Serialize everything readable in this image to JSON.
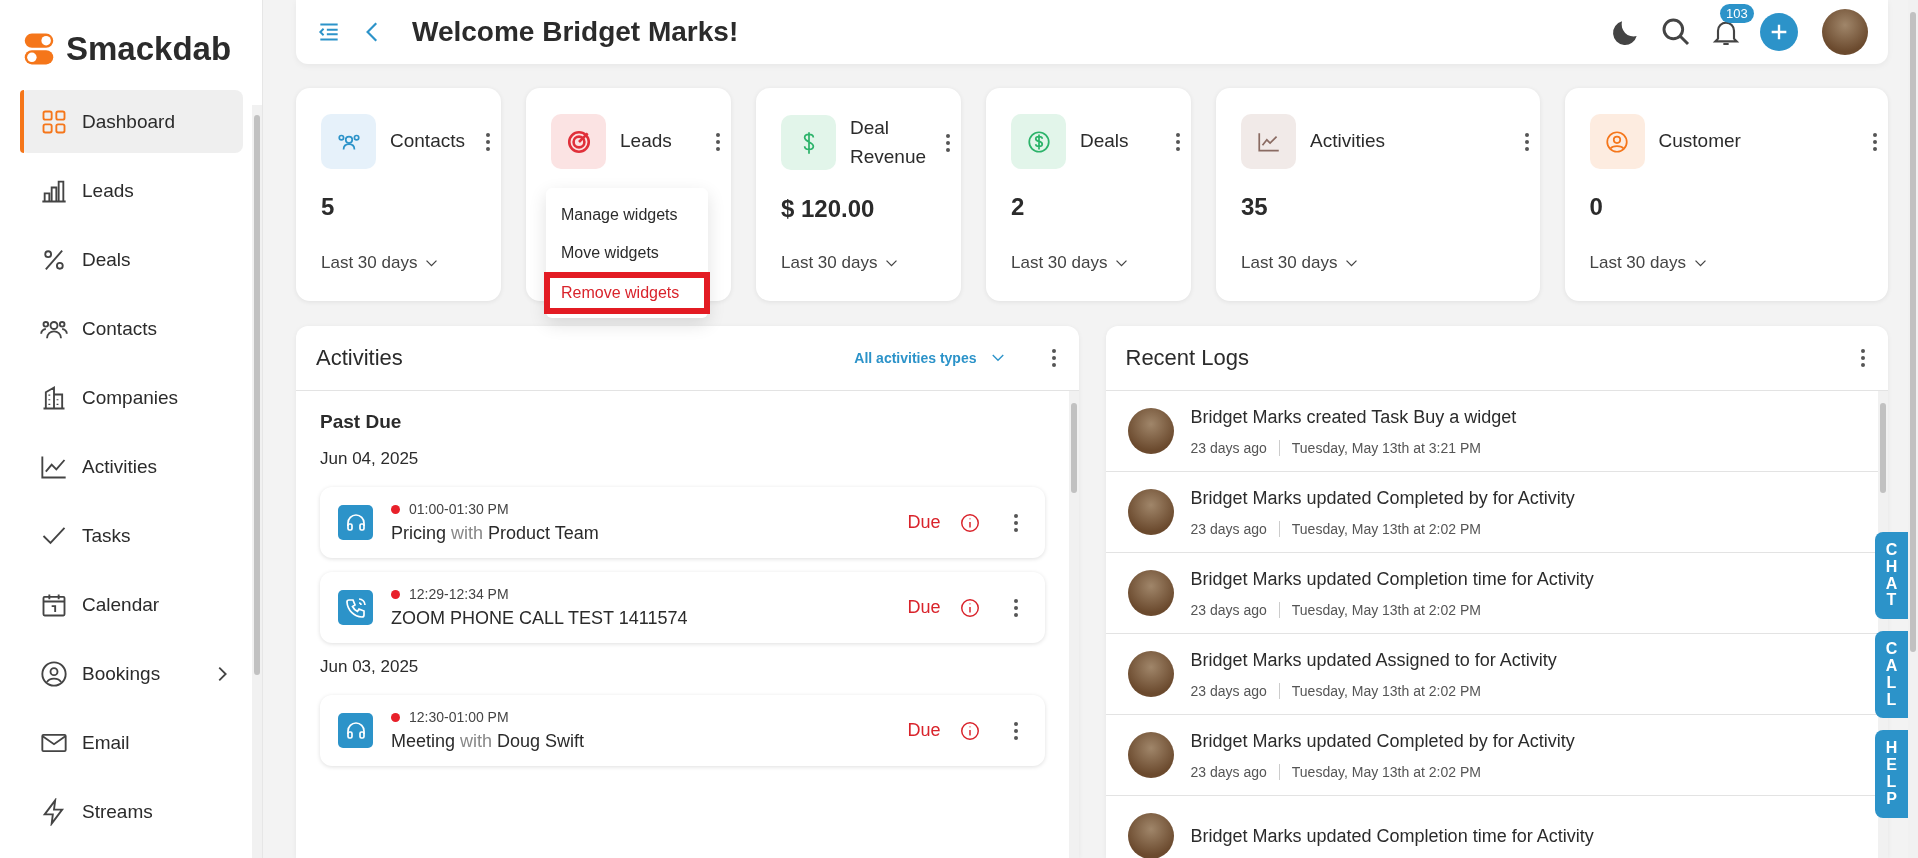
{
  "brand": {
    "name": "Smackdab"
  },
  "sidebar": {
    "items": [
      {
        "label": "Dashboard",
        "selected": true,
        "expandable": false
      },
      {
        "label": "Leads",
        "selected": false,
        "expandable": false
      },
      {
        "label": "Deals",
        "selected": false,
        "expandable": false
      },
      {
        "label": "Contacts",
        "selected": false,
        "expandable": false
      },
      {
        "label": "Companies",
        "selected": false,
        "expandable": false
      },
      {
        "label": "Activities",
        "selected": false,
        "expandable": false
      },
      {
        "label": "Tasks",
        "selected": false,
        "expandable": false
      },
      {
        "label": "Calendar",
        "selected": false,
        "expandable": false
      },
      {
        "label": "Bookings",
        "selected": false,
        "expandable": true
      },
      {
        "label": "Email",
        "selected": false,
        "expandable": false
      },
      {
        "label": "Streams",
        "selected": false,
        "expandable": false
      }
    ]
  },
  "header": {
    "title": "Welcome Bridget Marks!",
    "notification_count": "103"
  },
  "stats": [
    {
      "kind": "contacts",
      "label": "Contacts",
      "value": "5",
      "period": "Last 30 days"
    },
    {
      "kind": "leads",
      "label": "Leads",
      "menu": [
        {
          "label": "Manage widgets",
          "highlighted": false
        },
        {
          "label": "Move widgets",
          "highlighted": false
        },
        {
          "label": "Remove widgets",
          "highlighted": true
        }
      ]
    },
    {
      "kind": "revenue",
      "label": "Deal Revenue",
      "value": "$ 120.00",
      "period": "Last 30 days"
    },
    {
      "kind": "deals",
      "label": "Deals",
      "value": "2",
      "period": "Last 30 days"
    },
    {
      "kind": "activities",
      "label": "Activities",
      "value": "35",
      "period": "Last 30 days"
    },
    {
      "kind": "customer",
      "label": "Customer",
      "value": "0",
      "period": "Last 30 days"
    }
  ],
  "activities": {
    "title": "Activities",
    "filter": "All activities types",
    "section": "Past Due",
    "groups": [
      {
        "date": "Jun 04, 2025",
        "items": [
          {
            "kind": "meeting",
            "time": "01:00-01:30 PM",
            "title": "Pricing",
            "connector": "with",
            "party": "Product Team",
            "status": "Due"
          },
          {
            "kind": "call",
            "time": "12:29-12:34 PM",
            "title": "ZOOM PHONE CALL TEST 1411574",
            "status": "Due"
          }
        ]
      },
      {
        "date": "Jun 03, 2025",
        "items": [
          {
            "kind": "meeting",
            "time": "12:30-01:00 PM",
            "title": "Meeting",
            "connector": "with",
            "party": "Doug Swift",
            "status": "Due"
          }
        ]
      }
    ]
  },
  "recent_logs": {
    "title": "Recent Logs",
    "items": [
      {
        "text": "Bridget Marks created Task Buy a widget",
        "ago": "23 days ago",
        "when": "Tuesday, May 13th at 3:21 PM"
      },
      {
        "text": "Bridget Marks updated Completed by for Activity",
        "ago": "23 days ago",
        "when": "Tuesday, May 13th at 2:02 PM"
      },
      {
        "text": "Bridget Marks updated Completion time for Activity",
        "ago": "23 days ago",
        "when": "Tuesday, May 13th at 2:02 PM"
      },
      {
        "text": "Bridget Marks updated Assigned to for Activity",
        "ago": "23 days ago",
        "when": "Tuesday, May 13th at 2:02 PM"
      },
      {
        "text": "Bridget Marks updated Completed by for Activity",
        "ago": "23 days ago",
        "when": "Tuesday, May 13th at 2:02 PM"
      },
      {
        "text": "Bridget Marks updated Completion time for Activity"
      }
    ]
  },
  "side_tabs": [
    "CHAT",
    "CALL",
    "HELP"
  ]
}
